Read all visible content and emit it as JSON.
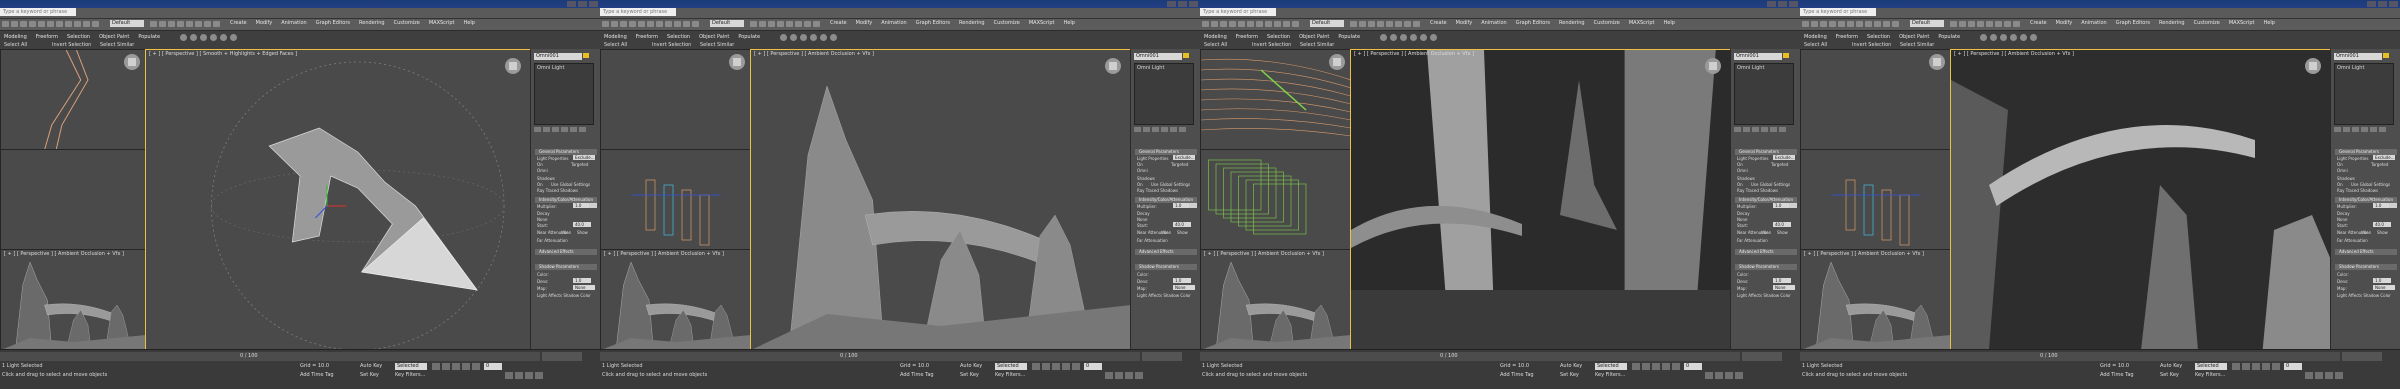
{
  "app": {
    "title_text": "",
    "search_placeholder": "Type a keyword or phrase",
    "workspace_value": "Default",
    "menu": [
      "Create",
      "Modify",
      "Animation",
      "Graph Editors",
      "Rendering",
      "Customize",
      "MAXScript",
      "Help"
    ],
    "ribbon_tabs": [
      "Modeling",
      "Freeform",
      "Selection",
      "Object Paint",
      "Populate"
    ],
    "panel_controls": [
      "Select All",
      "Invert Selection",
      "Select Similar"
    ]
  },
  "panels": [
    {
      "viewport_main_label": "[ + ] [ Perspective ] [ Smooth + Highlights + Edged Faces ]",
      "viewport_bl_label": "[ + ] [ Perspective ] [ Ambient Occlusion + Vfx ]",
      "status_prompt": "Click and drag to select and move objects",
      "selection_status": "1 Light Selected",
      "autokey_label": "Auto Key",
      "setkey_label": "Set Key",
      "selected_label": "Selected",
      "frame_counter": "0 / 100",
      "frame_value": "0",
      "grid_label": "Grid = 10.0",
      "addtime_label": "Add Time Tag",
      "keyfilters_label": "Key Filters..."
    },
    {
      "viewport_main_label": "[ + ] [ Perspective ] [ Ambient Occlusion + Vfx ]",
      "viewport_bl_label": "[ + ] [ Perspective ] [ Ambient Occlusion + Vfx ]",
      "status_prompt": "Click and drag to select and move objects",
      "selection_status": "1 Light Selected",
      "autokey_label": "Auto Key",
      "setkey_label": "Set Key",
      "selected_label": "Selected",
      "frame_counter": "0 / 100",
      "frame_value": "0",
      "grid_label": "Grid = 10.0",
      "addtime_label": "Add Time Tag",
      "keyfilters_label": "Key Filters..."
    },
    {
      "viewport_main_label": "[ + ] [ Perspective ] [ Ambient Occlusion + Vfx ]",
      "viewport_bl_label": "[ + ] [ Perspective ] [ Ambient Occlusion + Vfx ]",
      "status_prompt": "Click and drag to select and move objects",
      "selection_status": "1 Light Selected",
      "autokey_label": "Auto Key",
      "setkey_label": "Set Key",
      "selected_label": "Selected",
      "frame_counter": "0 / 100",
      "frame_value": "0",
      "grid_label": "Grid = 10.0",
      "addtime_label": "Add Time Tag",
      "keyfilters_label": "Key Filters..."
    },
    {
      "viewport_main_label": "[ + ] [ Perspective ] [ Ambient Occlusion + Vfx ]",
      "viewport_bl_label": "[ + ] [ Perspective ] [ Ambient Occlusion + Vfx ]",
      "status_prompt": "Click and drag to select and move objects",
      "selection_status": "1 Light Selected",
      "autokey_label": "Auto Key",
      "setkey_label": "Set Key",
      "selected_label": "Selected",
      "frame_counter": "0 / 100",
      "frame_value": "0",
      "grid_label": "Grid = 10.0",
      "addtime_label": "Add Time Tag",
      "keyfilters_label": "Key Filters..."
    }
  ],
  "command_panel": {
    "object_name": "Omni001",
    "list_item": "Omni Light",
    "rollouts": [
      "General Parameters",
      "Intensity/Color/Attenuation",
      "Advanced Effects",
      "Shadow Parameters"
    ],
    "light_props": [
      "Light Properties",
      "On",
      "Omni",
      "Targeted"
    ],
    "shadows": [
      "Shadows",
      "On",
      "Use Global Settings",
      "Ray Traced Shadows"
    ],
    "multiplier_label": "Multiplier:",
    "multiplier_value": "1.0",
    "decay_label": "Decay",
    "decay_type": "None",
    "start_label": "Start:",
    "start_value": "40.0",
    "near_atten": "Near Attenuation",
    "far_atten": "Far Attenuation",
    "use_label": "Use",
    "show_label": "Show",
    "color_label": "Color:",
    "dens_label": "Dens:",
    "dens_value": "1.0",
    "map_label": "Map:",
    "none_label": "None",
    "light_affects": "Light Affects Shadow Color",
    "exclude_label": "Exclude..."
  },
  "colors": {
    "title_blue": "#1f3c80",
    "ui_gray": "#444444",
    "active_border": "#f0c040",
    "spline_orange": "#d98f5a",
    "wire_green": "#7fd34a",
    "cyan_light": "#40c0e0"
  }
}
